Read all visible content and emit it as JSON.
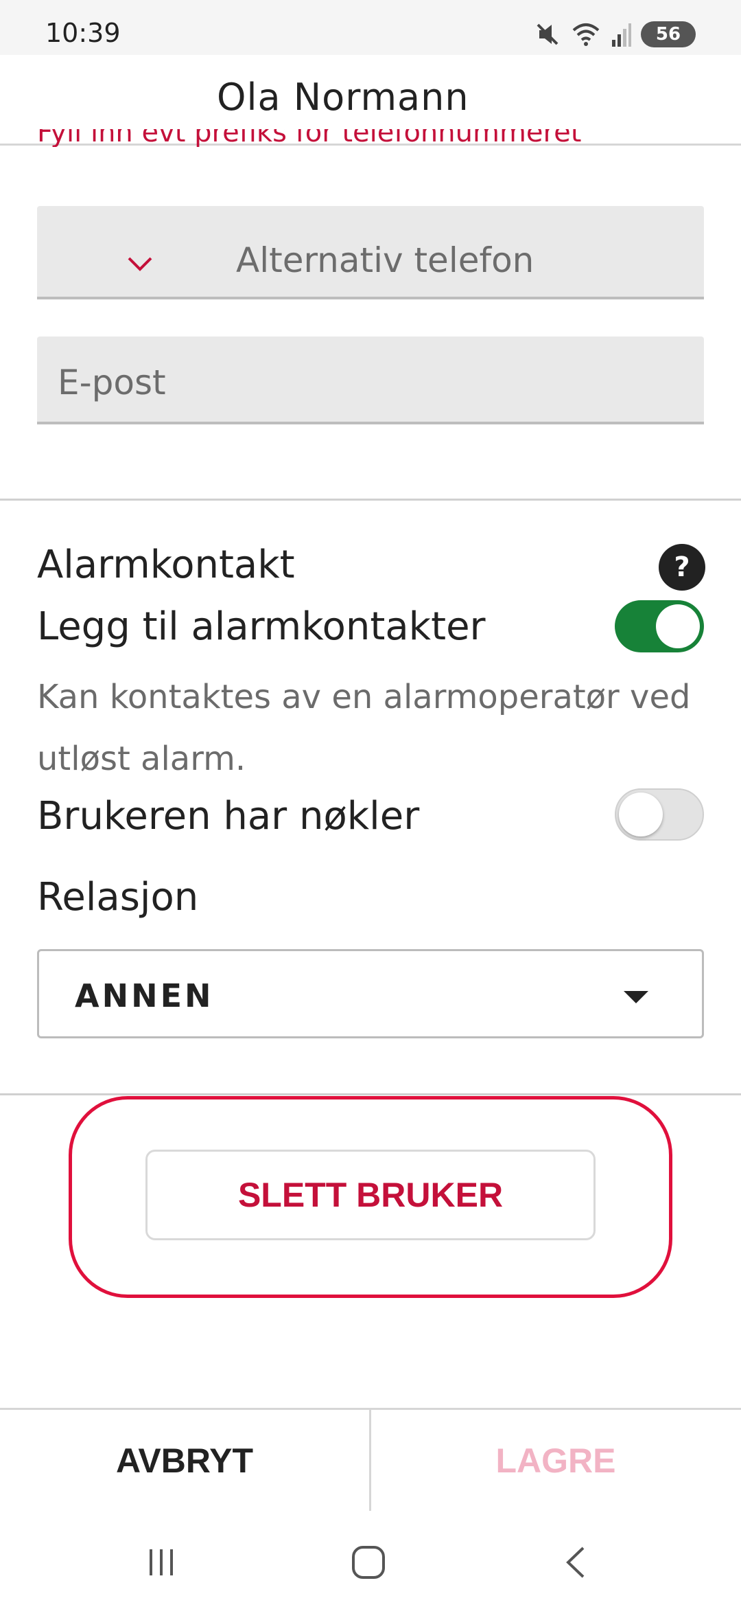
{
  "status_bar": {
    "time": "10:39",
    "battery": "56",
    "icons": [
      "mute-icon",
      "wifi-icon",
      "signal-icon",
      "battery-icon"
    ]
  },
  "app_bar": {
    "title": "Ola Normann"
  },
  "form": {
    "phone_hint": "Fyll inn evt prefiks for telefonnummeret",
    "alt_phone_label": "Alternativ telefon",
    "email_placeholder": "E-post"
  },
  "alarm": {
    "section_title": "Alarmkontakt",
    "help_symbol": "?",
    "add_contacts_label": "Legg til alarmkontakter",
    "add_contacts_on": true,
    "description": "Kan kontaktes av en alarmoperatør ved utløst alarm.",
    "has_keys_label": "Brukeren har nøkler",
    "has_keys_on": false,
    "relation_label": "Relasjon",
    "relation_value": "ANNEN"
  },
  "actions": {
    "delete_label": "SLETT BRUKER",
    "cancel_label": "AVBRYT",
    "save_label": "LAGRE"
  },
  "colors": {
    "accent_red": "#c4103a",
    "toggle_green": "#178238",
    "highlight_red": "#e0103c"
  }
}
